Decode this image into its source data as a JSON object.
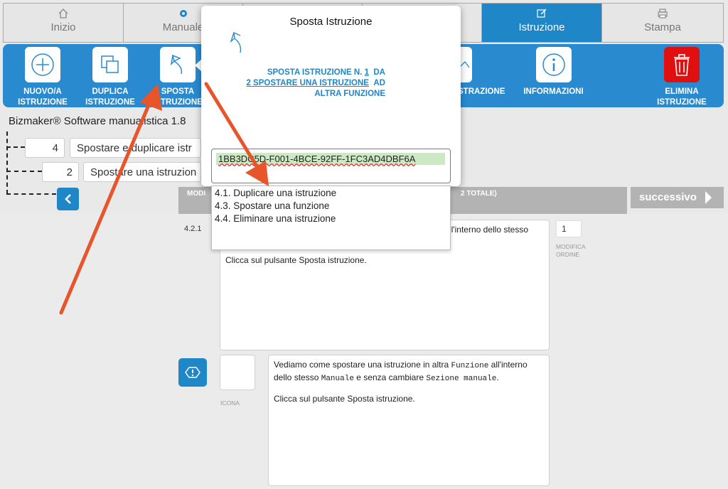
{
  "tabs": [
    {
      "label": "Inizio",
      "icon": "home-icon"
    },
    {
      "label": "Manuale",
      "icon": "gear-icon"
    },
    {
      "label": "",
      "icon": ""
    },
    {
      "label": "",
      "icon": ""
    },
    {
      "label": "Istruzione",
      "icon": "edit-icon",
      "active": true
    },
    {
      "label": "Stampa",
      "icon": "printer-icon"
    }
  ],
  "toolbar": {
    "new": {
      "label1": "NUOVO/A",
      "label2": "ISTRUZIONE",
      "icon": "plus-circle-icon"
    },
    "duplicate": {
      "label1": "DUPLICA",
      "label2": "ISTRUZIONE",
      "icon": "duplicate-icon"
    },
    "move": {
      "label1": "SPOSTA",
      "label2": "ISTRUZIONE",
      "icon": "move-arrow-icon"
    },
    "illustration": {
      "label": "STRAZIONE",
      "icon": "image-icon"
    },
    "info": {
      "label": "INFORMAZIONI",
      "icon": "info-icon"
    },
    "delete": {
      "label1": "ELIMINA",
      "label2": "ISTRUZIONE",
      "icon": "trash-icon"
    },
    "accent": "#2a8ad0",
    "delete_color": "#e01010"
  },
  "app_title": "Bizmaker® Software manualistica 1.8",
  "breadcrumb": [
    {
      "num": "4",
      "text": "Spostare e duplicare istr"
    },
    {
      "num": "2",
      "text": "Spostare una istruzion"
    }
  ],
  "strip": {
    "left": "MODI",
    "right": "2 TOTALE)"
  },
  "next_label": "successivo",
  "step": {
    "number": "4.2.1",
    "text_partial": "ll'interno dello stesso",
    "text_click": "Clicca sul pulsante Sposta istruzione.",
    "order": "1",
    "order_label_1": "MODIFICA",
    "order_label_2": "ORDINE"
  },
  "second": {
    "icon_label": "ICONA",
    "p1": "Vediamo come spostare una istruzione in altra",
    "kw1": "Funzione",
    "p2": "all'interno",
    "p3": "dello stesso",
    "kw2": "Manuale",
    "p4": "e senza cambiare",
    "kw3": "Sezione manuale",
    "p5": ".",
    "p6": "Clicca sul pulsante Sposta istruzione."
  },
  "popover": {
    "title": "Sposta Istruzione",
    "line1a": "SPOSTA ISTRUZIONE N.",
    "line1n": "1",
    "line1b": "DA",
    "line2a": "2 SPOSTARE UNA ISTRUZIONE",
    "line2b": "AD",
    "line3": "ALTRA FUNZIONE",
    "input_value": "1BB3DC5D-F001-4BCE-92FF-1FC3AD4DBF6A",
    "options": [
      "4.1. Duplicare una istruzione",
      "4.3. Spostare una funzione",
      "4.4. Eliminare una istruzione"
    ]
  },
  "annotation_color": "#e8552a"
}
